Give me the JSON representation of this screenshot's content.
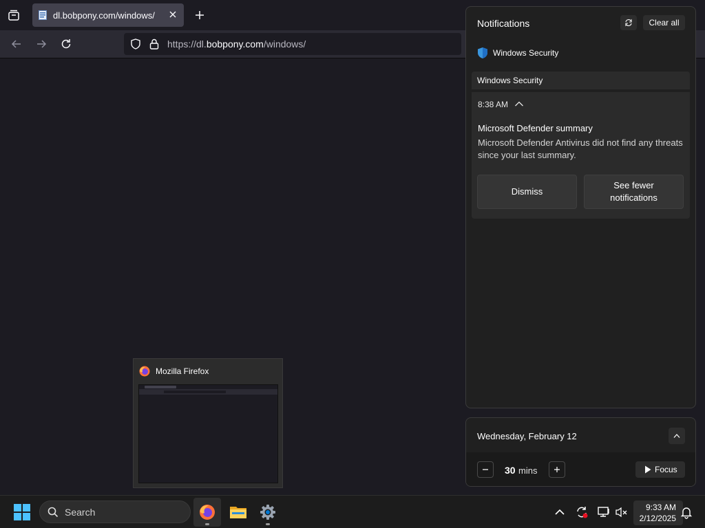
{
  "browser": {
    "tab": {
      "title": "dl.bobpony.com/windows/"
    },
    "url": {
      "prefix": "https://dl.",
      "domain": "bobpony.com",
      "suffix": "/windows/"
    }
  },
  "preview": {
    "title": "Mozilla Firefox"
  },
  "notifications": {
    "title": "Notifications",
    "clear_all": "Clear all",
    "app_name": "Windows Security",
    "group_header": "Windows Security",
    "toast": {
      "time": "8:38 AM",
      "heading": "Microsoft Defender summary",
      "body": "Microsoft Defender Antivirus did not find any threats since your last summary.",
      "dismiss": "Dismiss",
      "see_fewer": "See fewer notifications"
    }
  },
  "calendar": {
    "date": "Wednesday, February 12",
    "focus": {
      "value": "30",
      "unit": "mins",
      "button": "Focus"
    }
  },
  "taskbar": {
    "search_placeholder": "Search",
    "clock": {
      "time": "9:33 AM",
      "date": "2/12/2025"
    }
  },
  "colors": {
    "accent": "#0078d4",
    "firefox": "#ff7139",
    "security_blue": "#3a96dd"
  }
}
